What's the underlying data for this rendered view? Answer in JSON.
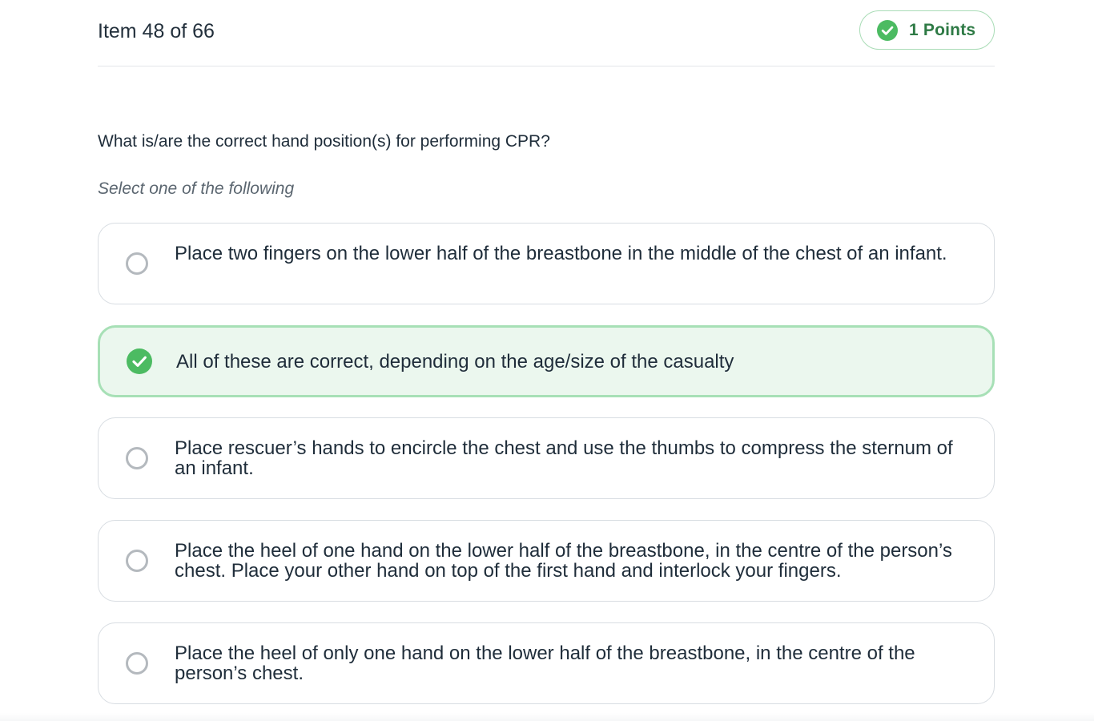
{
  "header": {
    "item_counter": "Item 48 of 66",
    "points_label": "1 Points"
  },
  "question": {
    "text": "What is/are the correct hand position(s) for performing CPR?",
    "instruction": "Select one of the following"
  },
  "options": [
    {
      "label": "Place two fingers on the lower half of the breastbone in the middle of the chest of an infant.",
      "selected": false
    },
    {
      "label": "All of these are correct, depending on the age/size of the casualty",
      "selected": true
    },
    {
      "label": "Place rescuer’s hands to encircle the chest and use the thumbs to compress the sternum of an infant.",
      "selected": false
    },
    {
      "label": "Place the heel of one hand on the lower half of the breastbone, in the centre of the person’s chest. Place your other hand on top of the first hand and interlock your fingers.",
      "selected": false
    },
    {
      "label": "Place the heel of only one hand on the lower half of the breastbone, in the centre of the person’s chest.",
      "selected": false
    }
  ],
  "icons": {
    "points": "check-circle-icon",
    "selected_option": "check-circle-icon",
    "unselected_option": "radio-empty-icon"
  },
  "colors": {
    "accent_green": "#4cbb62",
    "points_text": "#2e7a45",
    "selected_border": "#a7e0b6",
    "selected_background": "#ebf7ee"
  }
}
